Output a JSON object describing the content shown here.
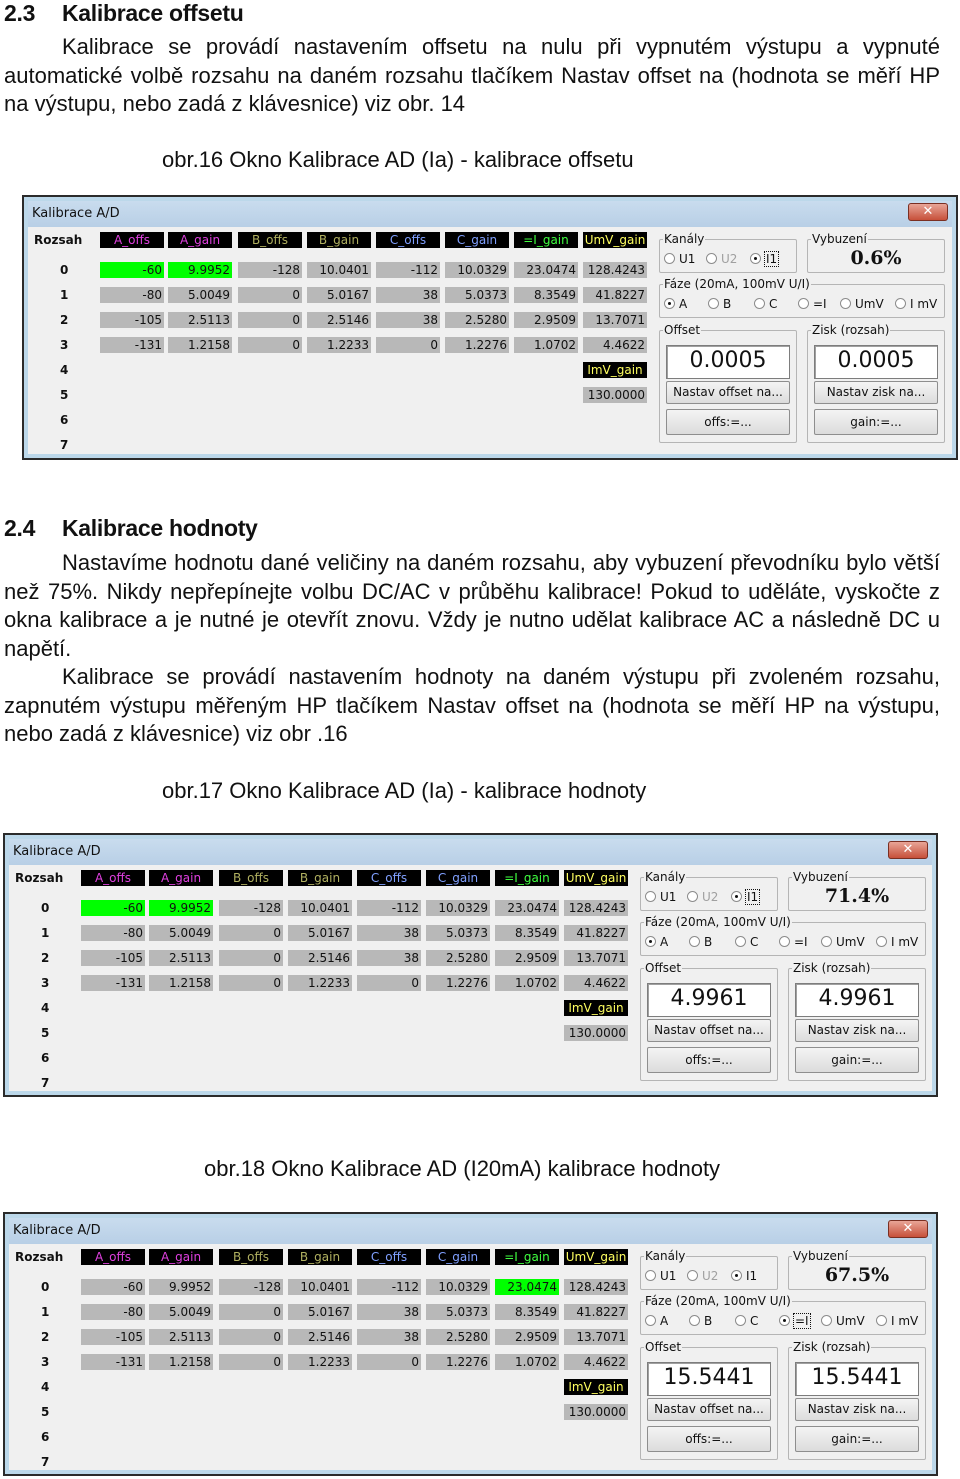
{
  "section_23": {
    "number": "2.3",
    "title": "Kalibrace offsetu",
    "paragraph": "Kalibrace se provádí nastavením offsetu na nulu při vypnutém výstupu a vypnuté automatické volbě rozsahu na daném rozsahu tlačíkem Nastav offset na (hodnota se měří HP na výstupu, nebo zadá z klávesnice) viz obr. 14"
  },
  "fig16_caption": "obr.16 Okno Kalibrace AD (Ia) - kalibrace offsetu",
  "section_24": {
    "number": "2.4",
    "title": "Kalibrace hodnoty",
    "paragraph1": "Nastavíme hodnotu dané veličiny na daném rozsahu,  aby vybuzení převodníku bylo větší než 75%. Nikdy nepřepínejte volbu DC/AC v průběhu kalibrace! Pokud to uděláte, vyskočte z okna kalibrace a je nutné je otevřít znovu. Vždy je nutno udělat kalibrace AC a následně DC u napětí.",
    "paragraph2": "Kalibrace se provádí nastavením hodnoty na daném výstupu při zvoleném rozsahu, zapnutém výstupu  měřeným HP tlačíkem Nastav offset na (hodnota se měří HP na výstupu, nebo zadá z klávesnice) viz obr .16"
  },
  "fig17_caption": "obr.17 Okno Kalibrace AD (Ia) - kalibrace hodnoty",
  "fig18_caption": "obr.18 Okno Kalibrace AD (I20mA) kalibrace hodnoty",
  "colors": {
    "highlight_green": "#00ff00",
    "cell_gray": "#b8b8b8",
    "header_bg": "#000000",
    "header_A": "#e040e0",
    "header_B": "#b0b060",
    "header_C": "#80a0ff",
    "header_I": "#40ff40",
    "header_UmV": "#ffff60"
  },
  "dialog_common": {
    "title": "Kalibrace A/D",
    "close_glyph": "✕",
    "rozsah_label": "Rozsah",
    "row_labels": [
      "0",
      "1",
      "2",
      "3",
      "4",
      "5",
      "6",
      "7"
    ],
    "columns": [
      {
        "label": "A_offs",
        "color": "#e040e0"
      },
      {
        "label": "A_gain",
        "color": "#e040e0"
      },
      {
        "label": "B_offs",
        "color": "#b0b060"
      },
      {
        "label": "B_gain",
        "color": "#b0b060"
      },
      {
        "label": "C_offs",
        "color": "#80a0ff"
      },
      {
        "label": "C_gain",
        "color": "#80a0ff"
      },
      {
        "label": "=I_gain",
        "color": "#40ff40"
      },
      {
        "label": "UmV_gain",
        "color": "#ffff60"
      }
    ],
    "rows": [
      [
        "-60",
        "9.9952",
        "-128",
        "10.0401",
        "-112",
        "10.0329",
        "23.0474",
        "128.4243"
      ],
      [
        "-80",
        "5.0049",
        "0",
        "5.0167",
        "38",
        "5.0373",
        "8.3549",
        "41.8227"
      ],
      [
        "-105",
        "2.5113",
        "0",
        "2.5146",
        "38",
        "2.5280",
        "2.9509",
        "13.7071"
      ],
      [
        "-131",
        "1.2158",
        "0",
        "1.2233",
        "0",
        "1.2276",
        "1.0702",
        "4.4622"
      ]
    ],
    "imv_label": "ImV_gain",
    "imv_label_color": "#ffff60",
    "imv_value": "130.0000",
    "kanaly_legend": "Kanály",
    "kanaly_options": [
      "U1",
      "U2",
      "I1"
    ],
    "vybuzeni_legend": "Vybuzení",
    "faze_legend": "Fáze (20mA, 100mV U/I)",
    "faze_options": [
      "A",
      "B",
      "C",
      "=I",
      "UmV",
      "I mV"
    ],
    "offset_legend": "Offset",
    "zisk_legend": "Zisk (rozsah)",
    "nastav_offset_label": "Nastav offset na...",
    "offs_assign_label": "offs:=...",
    "nastav_zisk_label": "Nastav zisk na...",
    "gain_assign_label": "gain:=..."
  },
  "dialogs": [
    {
      "figure": "obr.16",
      "vybuzeni": "0.6%",
      "offset_value": "0.0005",
      "zisk_value": "0.0005",
      "kanal_selected": "I1",
      "faze_selected": "A",
      "highlighted_cells": [
        "0.0",
        "0.1"
      ]
    },
    {
      "figure": "obr.17",
      "vybuzeni": "71.4%",
      "offset_value": "4.9961",
      "zisk_value": "4.9961",
      "kanal_selected": "I1",
      "faze_selected": "A",
      "highlighted_cells": [
        "0.0",
        "0.1"
      ]
    },
    {
      "figure": "obr.18",
      "vybuzeni": "67.5%",
      "offset_value": "15.5441",
      "zisk_value": "15.5441",
      "kanal_selected": "I1",
      "faze_selected": "=I",
      "highlighted_cells": [
        "0.6"
      ]
    }
  ]
}
